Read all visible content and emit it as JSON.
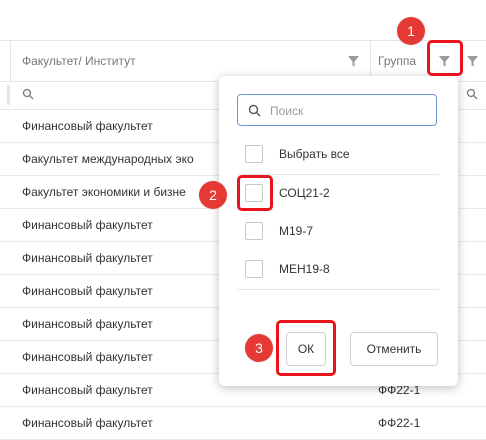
{
  "table": {
    "columns": {
      "faculty": "Факультет/ Институт",
      "group": "Группа"
    },
    "rows": [
      {
        "faculty": "Финансовый факультет",
        "group": ""
      },
      {
        "faculty": "Факультет международных эко",
        "group": ""
      },
      {
        "faculty": "Факультет экономики и бизне",
        "group": ""
      },
      {
        "faculty": "Финансовый факультет",
        "group": ""
      },
      {
        "faculty": "Финансовый факультет",
        "group": ""
      },
      {
        "faculty": "Финансовый факультет",
        "group": ""
      },
      {
        "faculty": "Финансовый факультет",
        "group": ""
      },
      {
        "faculty": "Финансовый факультет",
        "group": ""
      },
      {
        "faculty": "Финансовый факультет",
        "group": "ФФ22-1"
      },
      {
        "faculty": "Финансовый факультет",
        "group": "ФФ22-1"
      }
    ]
  },
  "filter_popup": {
    "search_placeholder": "Поиск",
    "select_all": "Выбрать все",
    "options": [
      "СОЦ21-2",
      "М19-7",
      "МЕН19-8"
    ],
    "ok_label": "ОК",
    "cancel_label": "Отменить"
  },
  "annotations": {
    "step1": "1",
    "step2": "2",
    "step3": "3"
  },
  "colors": {
    "highlight": "#e8141b",
    "badge": "#e53935",
    "focus_border": "#6a95d8"
  }
}
